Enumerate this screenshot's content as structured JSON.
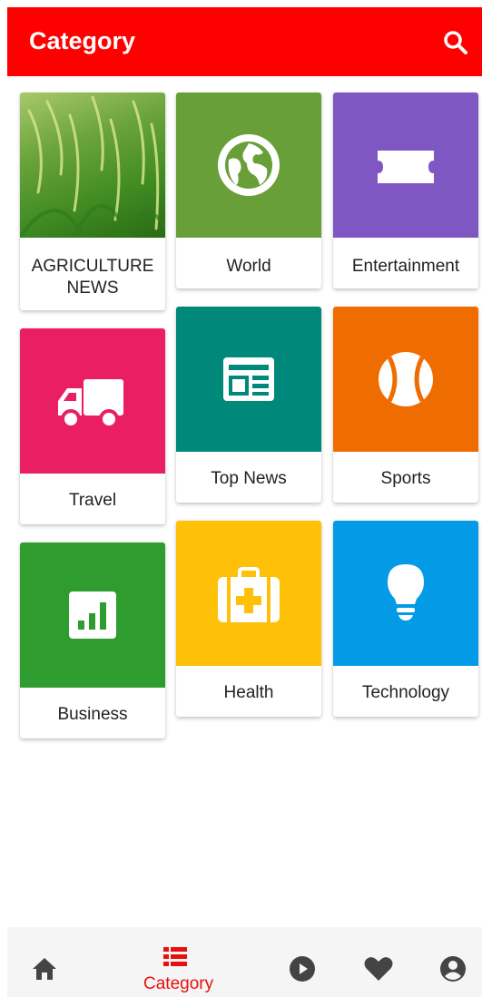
{
  "appbar": {
    "title": "Category",
    "color": "#ff0000",
    "search_icon": "search-icon"
  },
  "categories": [
    {
      "label": "AGRICULTURE NEWS",
      "tile_color": "#5d9a2e",
      "icon": "rice-field-photo"
    },
    {
      "label": "World",
      "tile_color": "#689f38",
      "icon": "globe-icon"
    },
    {
      "label": "Entertainment",
      "tile_color": "#7e57c2",
      "icon": "ticket-icon"
    },
    {
      "label": "Travel",
      "tile_color": "#e91e63",
      "icon": "truck-icon"
    },
    {
      "label": "Top News",
      "tile_color": "#00897b",
      "icon": "newspaper-icon"
    },
    {
      "label": "Sports",
      "tile_color": "#ef6c00",
      "icon": "baseball-icon"
    },
    {
      "label": "Business",
      "tile_color": "#2e9c2e",
      "icon": "bar-chart-icon"
    },
    {
      "label": "Health",
      "tile_color": "#ffc107",
      "icon": "medical-kit-icon"
    },
    {
      "label": "Technology",
      "tile_color": "#039be5",
      "icon": "lightbulb-icon"
    }
  ],
  "bottom_nav": {
    "active_label": "Category",
    "active_color": "#e8100f",
    "items": [
      "home-icon",
      "category-list-icon",
      "play-icon",
      "heart-icon",
      "account-icon"
    ]
  }
}
